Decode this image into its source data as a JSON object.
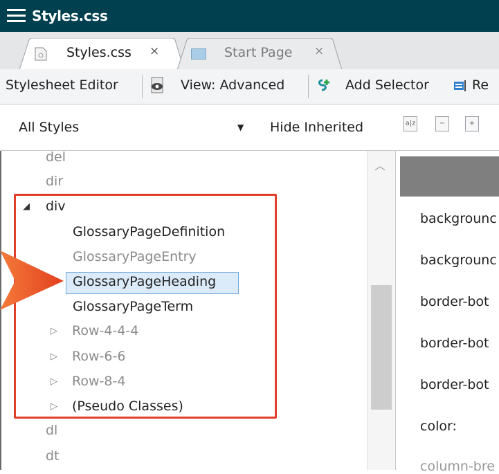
{
  "window": {
    "title": "Styles.css"
  },
  "tabs": [
    {
      "label": "Styles.css",
      "close": "×",
      "active": true,
      "icon": "css-file-icon"
    },
    {
      "label": "Start Page",
      "close": "×",
      "active": false,
      "icon": "start-page-icon"
    }
  ],
  "toolbar": {
    "editor_label": "Stylesheet Editor",
    "view_label": "View: Advanced",
    "add_selector_label": "Add Selector",
    "extra_label": "Re"
  },
  "filter": {
    "selected": "All Styles",
    "hide_inherited_label": "Hide Inherited"
  },
  "tree": {
    "top_partial": "del",
    "items_before": [
      "dir"
    ],
    "expanded": "div",
    "children": [
      {
        "label": "GlossaryPageDefinition",
        "style": "normal"
      },
      {
        "label": "GlossaryPageEntry",
        "style": "gray"
      },
      {
        "label": "GlossaryPageHeading",
        "style": "selected"
      },
      {
        "label": "GlossaryPageTerm",
        "style": "normal"
      }
    ],
    "collapsed_children": [
      {
        "label": "Row-4-4-4",
        "style": "gray"
      },
      {
        "label": "Row-6-6",
        "style": "gray"
      },
      {
        "label": "Row-8-4",
        "style": "gray"
      },
      {
        "label": "(Pseudo Classes)",
        "style": "normal"
      }
    ],
    "items_after": [
      "dl",
      "dt"
    ]
  },
  "properties": [
    "backgrounc",
    "backgrounc",
    "border-bot",
    "border-bot",
    "border-bot",
    "color:",
    "column-bre"
  ],
  "colors": {
    "titlebar": "#00404f",
    "callout": "#e8502a",
    "highlight_box": "#e0402a",
    "selection": "#dcebfa"
  }
}
